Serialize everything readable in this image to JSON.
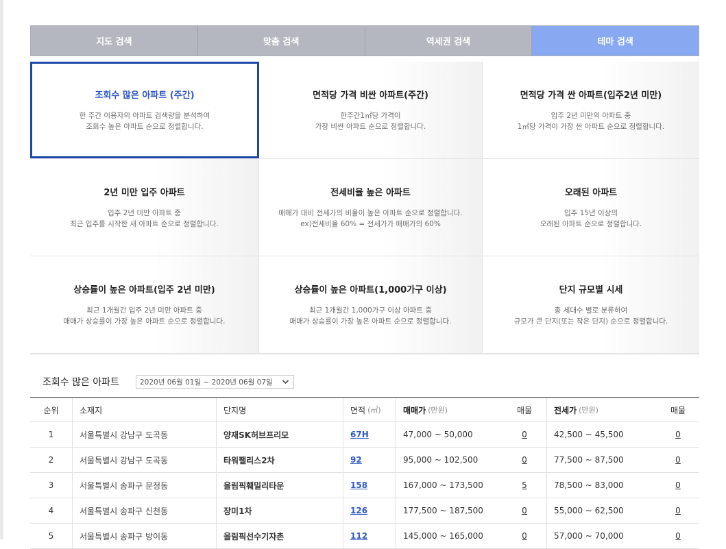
{
  "tabs": [
    {
      "label": "지도 검색"
    },
    {
      "label": "맞춤 검색"
    },
    {
      "label": "역세권 검색"
    },
    {
      "label": "테마 검색"
    }
  ],
  "themes": [
    {
      "title": "조회수 많은 아파트 (주간)",
      "desc": "한 주간 이용자의 아파트 검색량을 분석하여\n조회수 높은 아파트 순으로 정렬합니다."
    },
    {
      "title": "면적당 가격 비싼 아파트(주간)",
      "desc": "한주간1㎡당 가격이\n가장 비싼 아파트 순으로 정렬합니다."
    },
    {
      "title": "면적당 가격 싼 아파트(입주2년 미만)",
      "desc": "입주 2년 미만의 아파트 중\n1㎡당 가격이 가장 싼 아파트 순으로 정렬합니다."
    },
    {
      "title": "2년 미만 입주 아파트",
      "desc": "입주 2년 미만 아파트 중\n최근 입주를 시작한 새 아파트 순으로 정렬합니다."
    },
    {
      "title": "전세비율 높은 아파트",
      "desc": "매매가 대비 전세가의 비율이 높은 아파트 순으로 정렬합니다.\nex)전세비율 60% = 전세가가 매매가의 60%"
    },
    {
      "title": "오래된 아파트",
      "desc": "입주 15년 이상의\n오래된 아파트 순으로 정렬합니다."
    },
    {
      "title": "상승률이 높은 아파트(입주 2년 미만)",
      "desc": "최근 1개월간 입주 2년 미만 아파트 중\n매매가 상승률이 가장 높은 아파트 순으로 정렬합니다."
    },
    {
      "title": "상승률이 높은 아파트(1,000가구 이상)",
      "desc": "최근 1개월간 1,000가구 이상 아파트 중\n매매가 상승률이 가장 높은 아파트 순으로 정렬합니다."
    },
    {
      "title": "단지 규모별 시세",
      "desc": "총 세대수 별로 분류하여\n규모가 큰 단지(또는 작은 단지) 순으로 정렬합니다."
    }
  ],
  "ranking": {
    "title": "조회수 많은 아파트",
    "date_range": "2020년 06월 01일 ~ 2020년 06월 07일",
    "headers": {
      "rank": "순위",
      "location": "소재지",
      "name": "단지명",
      "area": "면적",
      "area_unit": "(㎡)",
      "sale": "매매가",
      "sale_unit": "(만원)",
      "sale_count": "매물",
      "jeonse": "전세가",
      "jeonse_unit": "(만원)",
      "jeonse_count": "매물"
    },
    "rows": [
      {
        "rank": "1",
        "location": "서울특별시 강남구 도곡동",
        "name": "양재SK허브프리모",
        "area": "67H",
        "sale": "47,000 ~ 50,000",
        "sale_count": "0",
        "jeonse": "42,500 ~ 45,500",
        "jeonse_count": "0"
      },
      {
        "rank": "2",
        "location": "서울특별시 강남구 도곡동",
        "name": "타워팰리스2차",
        "area": "92",
        "sale": "95,000 ~ 102,500",
        "sale_count": "0",
        "jeonse": "77,500 ~ 87,500",
        "jeonse_count": "0"
      },
      {
        "rank": "3",
        "location": "서울특별시 송파구 문정동",
        "name": "올림픽훼밀리타운",
        "area": "158",
        "sale": "167,000 ~ 173,500",
        "sale_count": "5",
        "jeonse": "78,500 ~ 83,000",
        "jeonse_count": "0"
      },
      {
        "rank": "4",
        "location": "서울특별시 송파구 신천동",
        "name": "장미1차",
        "area": "126",
        "sale": "177,500 ~ 187,500",
        "sale_count": "0",
        "jeonse": "55,000 ~ 62,500",
        "jeonse_count": "0"
      },
      {
        "rank": "5",
        "location": "서울특별시 송파구 방이동",
        "name": "올림픽선수기자촌",
        "area": "112",
        "sale": "145,000 ~ 165,000",
        "sale_count": "0",
        "jeonse": "57,000 ~ 70,000",
        "jeonse_count": "0"
      }
    ]
  }
}
